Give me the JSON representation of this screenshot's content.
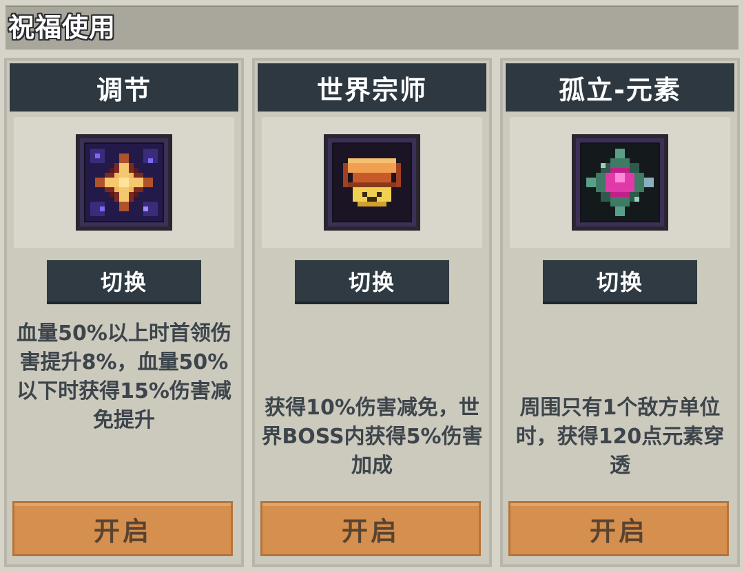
{
  "header": {
    "title": "祝福使用"
  },
  "cards": [
    {
      "title": "调节",
      "icon": "star-burst-icon",
      "switch_label": "切换",
      "description": "血量50%以上时首领伤害提升8%，血量50%以下时获得15%伤害减免提升",
      "open_label": "开启"
    },
    {
      "title": "世界宗师",
      "icon": "orange-crown-icon",
      "switch_label": "切换",
      "description": "获得10%伤害减免，世界BOSS内获得5%伤害加成",
      "open_label": "开启"
    },
    {
      "title": "孤立-元素",
      "icon": "pink-gem-icon",
      "switch_label": "切换",
      "description": "周围只有1个敌方单位时，获得120点元素穿透",
      "open_label": "开启"
    }
  ],
  "colors": {
    "background": "#d6d3c9",
    "header_strip": "#a9a69b",
    "card_title_bar": "#2e3840",
    "switch_button": "#2f3a42",
    "open_button": "#d58f4e",
    "description_text": "#3d454c"
  }
}
